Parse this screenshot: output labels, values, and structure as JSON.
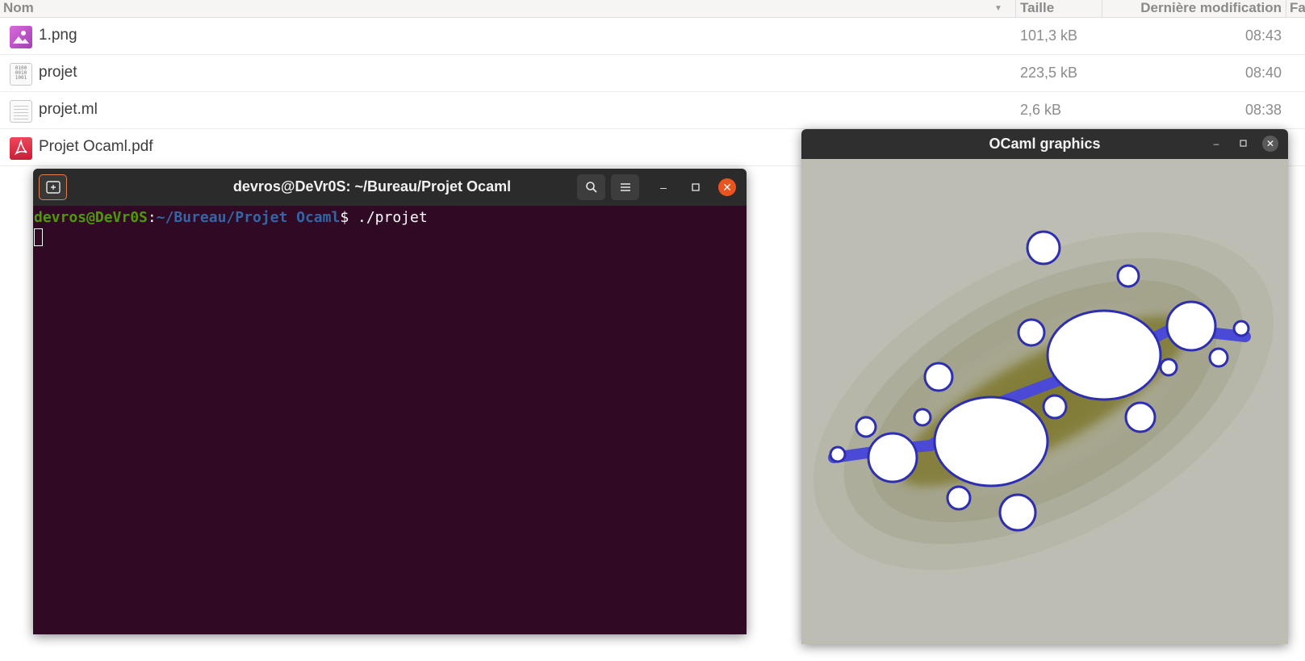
{
  "file_manager": {
    "columns": {
      "name": "Nom",
      "size": "Taille",
      "modified": "Dernière modification",
      "extra": "Fa"
    },
    "files": [
      {
        "name": "1.png",
        "size": "101,3 kB",
        "modified": "08:43",
        "icon": "image-file-icon"
      },
      {
        "name": "projet",
        "size": "223,5 kB",
        "modified": "08:40",
        "icon": "binary-file-icon"
      },
      {
        "name": "projet.ml",
        "size": "2,6 kB",
        "modified": "08:38",
        "icon": "text-file-icon"
      },
      {
        "name": "Projet Ocaml.pdf",
        "size": "",
        "modified": "",
        "icon": "pdf-file-icon"
      }
    ]
  },
  "terminal": {
    "title": "devros@DeVr0S: ~/Bureau/Projet Ocaml",
    "prompt_user": "devros@DeVr0S",
    "prompt_colon": ":",
    "prompt_path": "~/Bureau/Projet Ocaml",
    "prompt_cmd": "$ ./projet",
    "icons": {
      "new_tab": "new-tab-icon",
      "search": "search-icon",
      "menu": "hamburger-menu-icon"
    },
    "colors": {
      "background": "#300a24",
      "user": "#4e9a06",
      "path": "#3465a4",
      "close": "#e95420"
    }
  },
  "ocaml_window": {
    "title": "OCaml graphics",
    "content": "julia-set-fractal",
    "colors": {
      "background": "#bdbdb4",
      "glow": "#6f6a1e",
      "edge": "#3b3bd0",
      "interior": "#ffffff"
    }
  }
}
